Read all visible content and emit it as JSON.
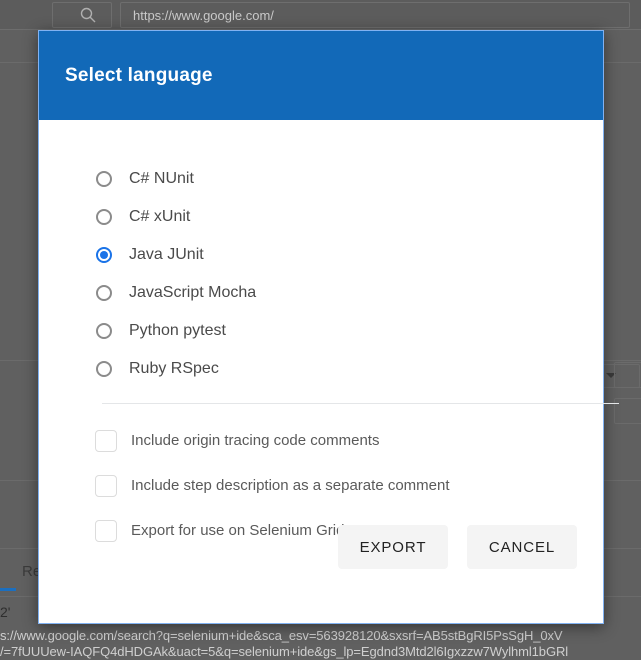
{
  "background": {
    "url_bar_value": "https://www.google.com/",
    "search_icon": "search-icon",
    "tab_label_partial": "Re",
    "table_cell_partial": "2'",
    "status_url_line1": "s://www.google.com/search?q=selenium+ide&sca_esv=563928120&sxsrf=AB5stBgRI5PsSgH_0xV",
    "status_url_line2": "/=7fUUUew-IAQFQ4dHDGAk&uact=5&q=selenium+ide&gs_lp=Egdnd3Mtd2l6Igxzzw7Wylhml1bGRl"
  },
  "dialog": {
    "title": "Select language",
    "languages": [
      {
        "label": "C# NUnit",
        "selected": false
      },
      {
        "label": "C# xUnit",
        "selected": false
      },
      {
        "label": "Java JUnit",
        "selected": true
      },
      {
        "label": "JavaScript Mocha",
        "selected": false
      },
      {
        "label": "Python pytest",
        "selected": false
      },
      {
        "label": "Ruby RSpec",
        "selected": false
      }
    ],
    "options": [
      {
        "label": "Include origin tracing code comments",
        "checked": false
      },
      {
        "label": "Include step description as a separate comment",
        "checked": false
      },
      {
        "label": "Export for use on Selenium Grid",
        "checked": false
      }
    ],
    "export_label": "EXPORT",
    "cancel_label": "CANCEL"
  },
  "colors": {
    "header_blue": "#1269b8",
    "accent_blue": "#1a73e8",
    "button_bg": "#f4f4f4"
  }
}
